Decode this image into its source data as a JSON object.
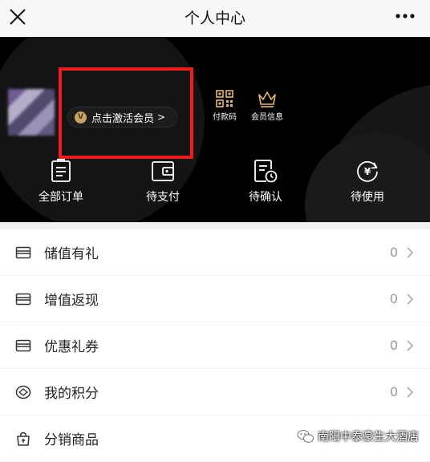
{
  "topbar": {
    "title": "个人中心"
  },
  "profile": {
    "vip_badge_letter": "V",
    "vip_label": "点击激活会员",
    "vip_chevron": ">"
  },
  "quick_actions": [
    {
      "label": "付款码",
      "icon": "qr-code-icon"
    },
    {
      "label": "会员信息",
      "icon": "crown-icon"
    }
  ],
  "orders": [
    {
      "label": "全部订单",
      "icon": "order-list-icon"
    },
    {
      "label": "待支付",
      "icon": "wallet-icon"
    },
    {
      "label": "待确认",
      "icon": "pending-confirm-icon"
    },
    {
      "label": "待使用",
      "icon": "yen-refresh-icon"
    }
  ],
  "menu": [
    {
      "label": "储值有礼",
      "count": "0",
      "icon": "card-icon"
    },
    {
      "label": "增值返现",
      "count": "0",
      "icon": "card-icon"
    },
    {
      "label": "优惠礼券",
      "count": "0",
      "icon": "card-icon"
    },
    {
      "label": "我的积分",
      "count": "0",
      "icon": "points-icon"
    },
    {
      "label": "分销商品",
      "icon": "bag-icon"
    }
  ],
  "watermark": {
    "text": "南阳中泰豪生大酒店"
  },
  "colors": {
    "highlight": "#ee1c1c",
    "vip_gold": "#c7a364",
    "header_bg": "#000000"
  }
}
